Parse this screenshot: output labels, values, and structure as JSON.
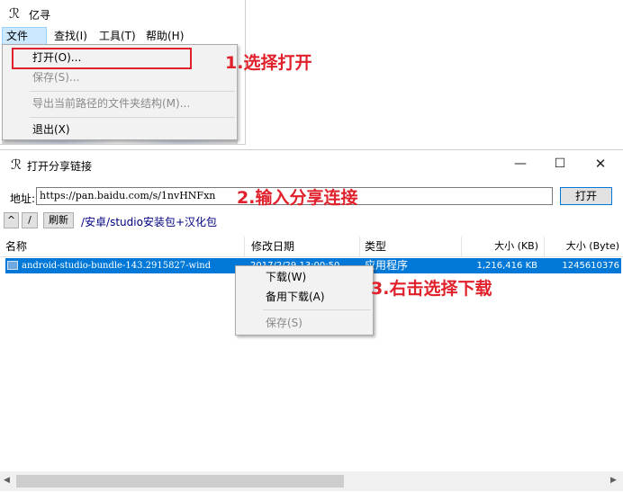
{
  "window1": {
    "title": "亿寻",
    "menubar": [
      "文件(F)",
      "查找(I)",
      "工具(T)",
      "帮助(H)"
    ],
    "file_menu": {
      "open": "打开(O)...",
      "save": "保存(S)...",
      "export": "导出当前路径的文件夹结构(M)...",
      "exit": "退出(X)"
    }
  },
  "annotations": {
    "step1": "1.选择打开",
    "step2": "2.输入分享连接",
    "step3": "3.右击选择下载"
  },
  "window2": {
    "title": "打开分享链接",
    "controls": {
      "minimize": "—",
      "maximize": "☐",
      "close": "✕"
    },
    "address_label": "地址:",
    "address_value": "https://pan.baidu.com/s/1nvHNFxn",
    "open_button": "打开",
    "nav": {
      "up": "^",
      "root": "/",
      "refresh": "刷新"
    },
    "path": "/安卓/studio安装包+汉化包",
    "columns": [
      "名称",
      "修改日期",
      "类型",
      "大小 (KB)",
      "大小 (Byte)"
    ],
    "rows": [
      {
        "name": "android-studio-bundle-143.2915827-wind",
        "date": "2017/2/29 13:00:50",
        "type": "应用程序",
        "size_kb": "1,216,416 KB",
        "size_bytes": "1245610376"
      }
    ],
    "context_menu": {
      "download": "下载(W)",
      "alt_download": "备用下载(A)",
      "save": "保存(S)"
    },
    "scrollbar": {
      "left_arrow": "◀",
      "right_arrow": "▶"
    }
  },
  "colors": {
    "selection": "#0078d7",
    "annotation": "#e0202a",
    "path_text": "#000080"
  },
  "icons": [
    "app-icon",
    "file-icon",
    "minimize-icon",
    "maximize-icon",
    "close-icon"
  ]
}
